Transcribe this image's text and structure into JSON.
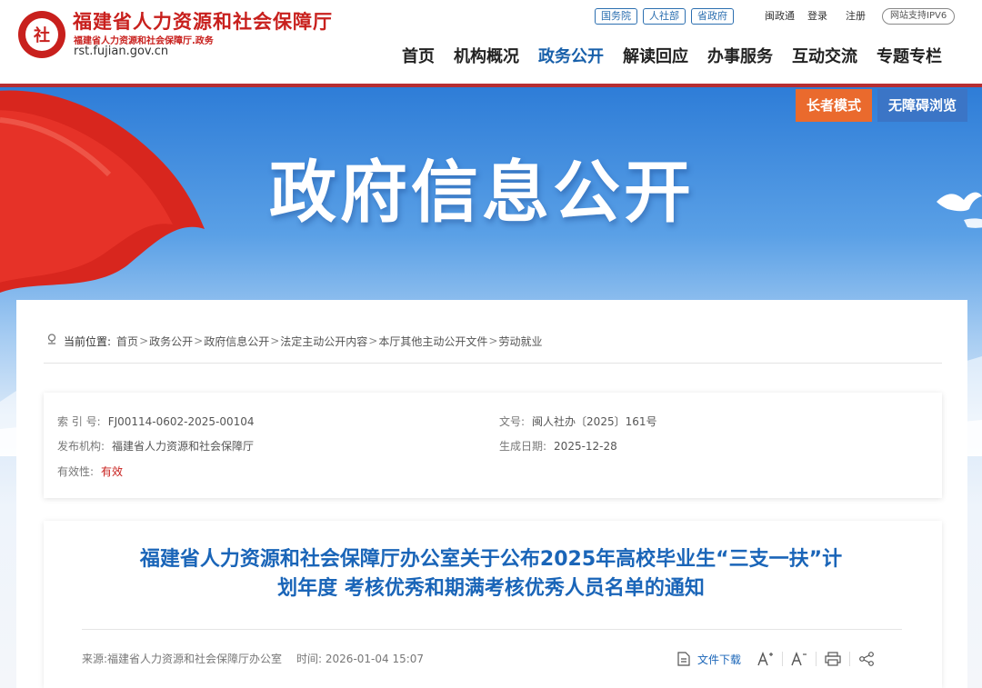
{
  "header": {
    "site_name": "福建省人力资源和社会保障厅",
    "site_sub": "福建省人力资源和社会保障厅.政务",
    "site_domain": "rst.fujian.gov.cn",
    "logo_char": "社",
    "top_tags": [
      "国务院",
      "人社部",
      "省政府"
    ],
    "top_links": [
      "闽政通",
      "登录",
      "注册"
    ],
    "ipv6": "网站支持IPV6",
    "nav": [
      "首页",
      "机构概况",
      "政务公开",
      "解读回应",
      "办事服务",
      "互动交流",
      "专题专栏"
    ],
    "nav_active_index": 2
  },
  "banner": {
    "title": "政府信息公开",
    "elder_mode": "长者模式",
    "accessible": "无障碍浏览"
  },
  "breadcrumb": {
    "label": "当前位置:",
    "items": [
      "首页",
      "政务公开",
      "政府信息公开",
      "法定主动公开内容",
      "本厅其他主动公开文件",
      "劳动就业"
    ],
    "separator": ">"
  },
  "meta": {
    "index_label": "索 引 号:",
    "index_value": "FJ00114-0602-2025-00104",
    "doc_no_label": "文号:",
    "doc_no_value": "闽人社办〔2025〕161号",
    "publisher_label": "发布机构:",
    "publisher_value": "福建省人力资源和社会保障厅",
    "date_label": "生成日期:",
    "date_value": "2025-12-28",
    "validity_label": "有效性:",
    "validity_value": "有效"
  },
  "article": {
    "title_line1": "福建省人力资源和社会保障厅办公室关于公布2025年高校毕业生“三支一扶”计",
    "title_line2": "划年度 考核优秀和期满考核优秀人员名单的通知",
    "source": "来源:福建省人力资源和社会保障厅办公室",
    "time": "时间:  2026-01-04 15:07",
    "download": "文件下载"
  },
  "colors": {
    "brand_red": "#c8201d",
    "link_blue": "#1a65b8",
    "elder_orange": "#ea6a2d",
    "accessible_blue": "#3b75c6"
  }
}
